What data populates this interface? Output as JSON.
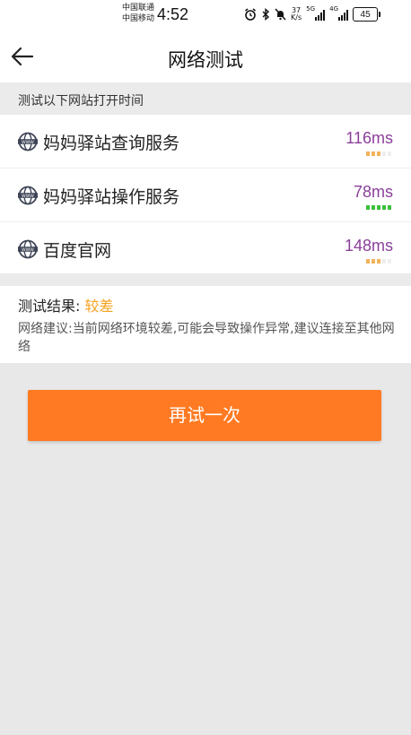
{
  "status_bar": {
    "carrier1": "中国联通",
    "carrier2": "中国移动",
    "time": "4:52",
    "net_speed_value": "37",
    "net_speed_unit": "K/s",
    "network1": "5G",
    "network2": "4G",
    "battery": "45"
  },
  "nav": {
    "title": "网络测试"
  },
  "section": {
    "header": "测试以下网站打开时间"
  },
  "sites": [
    {
      "name": "妈妈驿站查询服务",
      "time": "116ms",
      "signal_level": 3,
      "signal_color": "#f3b25c"
    },
    {
      "name": "妈妈驿站操作服务",
      "time": "78ms",
      "signal_level": 5,
      "signal_color": "#3cbf3a"
    },
    {
      "name": "百度官网",
      "time": "148ms",
      "signal_level": 3,
      "signal_color": "#f3b25c"
    }
  ],
  "result": {
    "label": "测试结果:",
    "value": "较差",
    "advice": "网络建议:当前网络环境较差,可能会导致操作异常,建议连接至其他网络"
  },
  "retry_button": "再试一次",
  "colors": {
    "accent": "#ff7a22",
    "latency_text": "#8b3f9a",
    "warning": "#f5a21f"
  }
}
